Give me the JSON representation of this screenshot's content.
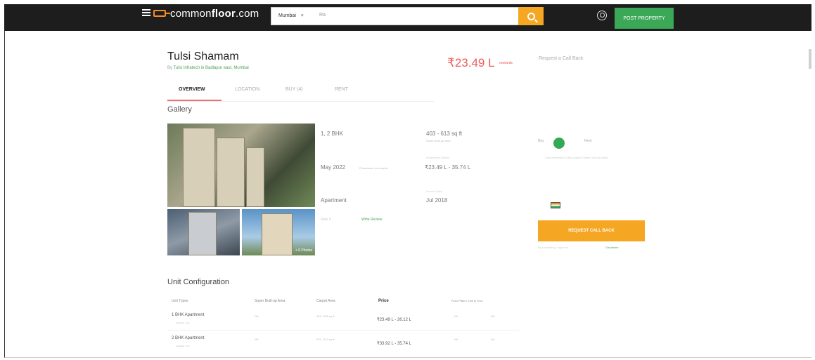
{
  "header": {
    "logo_prefix": "common",
    "logo_bold": "floor",
    "logo_suffix": ".com",
    "city": "Mumbai",
    "search_placeholder": "Ra",
    "post_property_label": "POST PROPERTY",
    "icons": [
      "menu-icon",
      "search-icon",
      "user-icon"
    ],
    "accent_color": "#f5a623",
    "brand_green": "#3aa857"
  },
  "project": {
    "name": "Tulsi Shamam",
    "by_label": "By",
    "developer_line": "Tulsi Infratech in Badlapur east, Mumbai",
    "price": "₹23.49 L",
    "price_note": "onwards",
    "callback_link": "Request a Call Back",
    "price_color": "#ef5b5b"
  },
  "tabs": [
    "OVERVIEW",
    "LOCATION",
    "BUY (4)",
    "RENT"
  ],
  "gallery": {
    "heading": "Gallery",
    "photo_count": "+ 6 Photos"
  },
  "facts": {
    "config": "1, 2 BHK",
    "area": "403 - 613 sq ft",
    "area_note": "Super Built-up area",
    "possession_cap": "Possession Status",
    "possession": "May 2022",
    "possession_note": "Possession on request",
    "price_range": "₹23.49 L - 35.74 L",
    "type": "Apartment",
    "launch_cap": "Launch Date",
    "launch": "Jul 2018",
    "rating": "Rate it",
    "rating_link": "Write Review"
  },
  "contact_card": {
    "toggle_left": "Buy",
    "toggle_right": "Rent",
    "message": "I am interested in this project. Please call me back.",
    "request_button": "REQUEST CALL BACK",
    "footer_text": "By submitting, I agree to",
    "footer_link": "Disclaimer"
  },
  "unit_config": {
    "heading": "Unit Configuration",
    "columns": [
      "Unit Types",
      "Super Built-up Area",
      "Carpet Area",
      "Price",
      "Floor Plans / Link to Tour"
    ],
    "rows": [
      {
        "type": "1 BHK Apartment",
        "sub": "Available  •  Yes",
        "sba": "NA",
        "carpet": "403 - 405 sq ft",
        "price": "₹23.49 L - 26.12 L",
        "plan1": "NA",
        "plan2": "NA"
      },
      {
        "type": "2 BHK Apartment",
        "sub": "Available  •  Yes",
        "sba": "NA",
        "carpet": "575 - 613 sq ft",
        "price": "₹33.92 L - 35.74 L",
        "plan1": "NA",
        "plan2": "NA"
      }
    ]
  }
}
